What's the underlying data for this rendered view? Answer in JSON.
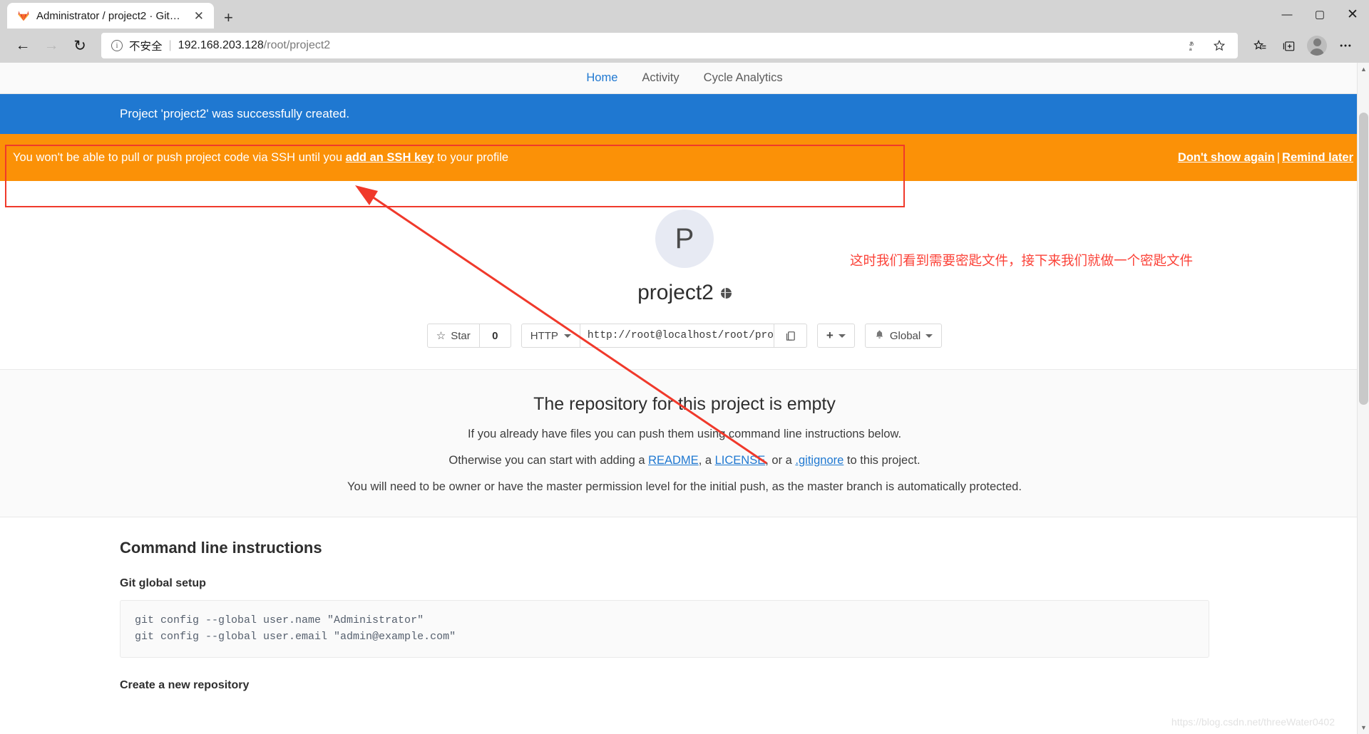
{
  "browser": {
    "tab": {
      "title": "Administrator / project2 · GitLab",
      "favicon": "gitlab-fox-icon",
      "close": "✕"
    },
    "new_tab_label": "+",
    "window_controls": {
      "minimize": "—",
      "maximize": "▢",
      "close": "✕"
    },
    "nav": {
      "back": "←",
      "forward": "→",
      "reload": "↻"
    },
    "omnibox": {
      "info": "i",
      "security_label": "不安全",
      "separator": "|",
      "url_host": "192.168.203.128",
      "url_path": "/root/project2"
    },
    "toolbar_right": {
      "translate": "translate-icon",
      "favorite": "star-add-icon",
      "favorites_list": "favorites-list-icon",
      "collections": "collections-icon",
      "profile": "profile-avatar-icon",
      "settings": "ellipsis-icon"
    }
  },
  "gitlab": {
    "nav_items": [
      {
        "label": "Home",
        "active": true
      },
      {
        "label": "Activity",
        "active": false
      },
      {
        "label": "Cycle Analytics",
        "active": false
      }
    ],
    "flash_success": "Project 'project2' was successfully created.",
    "ssh_banner": {
      "text_before": "You won't be able to pull or push project code via SSH until you ",
      "link": "add an SSH key",
      "text_after": " to your profile",
      "dont_show": "Don't show again",
      "separator": "|",
      "remind_later": "Remind later",
      "bg_color": "#fb9107"
    },
    "project": {
      "avatar_initial": "P",
      "name": "project2",
      "visibility_icon": "globe-icon"
    },
    "toolbar": {
      "star_icon": "☆",
      "star_label": "Star",
      "star_count": "0",
      "clone_protocol": "HTTP",
      "clone_url": "http://root@localhost/root/proje",
      "copy_icon": "copy-icon",
      "plus_label": "+",
      "notification_icon": "bell-icon",
      "notification_label": "Global"
    },
    "empty_repo": {
      "title": "The repository for this project is empty",
      "line1": "If you already have files you can push them using command line instructions below.",
      "line2_a": "Otherwise you can start with adding a ",
      "link_readme": "README",
      "line2_b": ", a ",
      "link_license": "LICENSE",
      "line2_c": ", or a ",
      "link_gitignore": ".gitignore",
      "line2_d": " to this project.",
      "line3": "You will need to be owner or have the master permission level for the initial push, as the master branch is automatically protected."
    },
    "cli": {
      "title": "Command line instructions",
      "global_setup_title": "Git global setup",
      "global_setup_code": "git config --global user.name \"Administrator\"\ngit config --global user.email \"admin@example.com\"",
      "create_repo_title": "Create a new repository"
    }
  },
  "annotation": {
    "note_cn": "这时我们看到需要密匙文件，接下来我们就做一个密匙文件",
    "color": "#fb4238"
  },
  "watermark": "https://blog.csdn.net/threeWater0402"
}
